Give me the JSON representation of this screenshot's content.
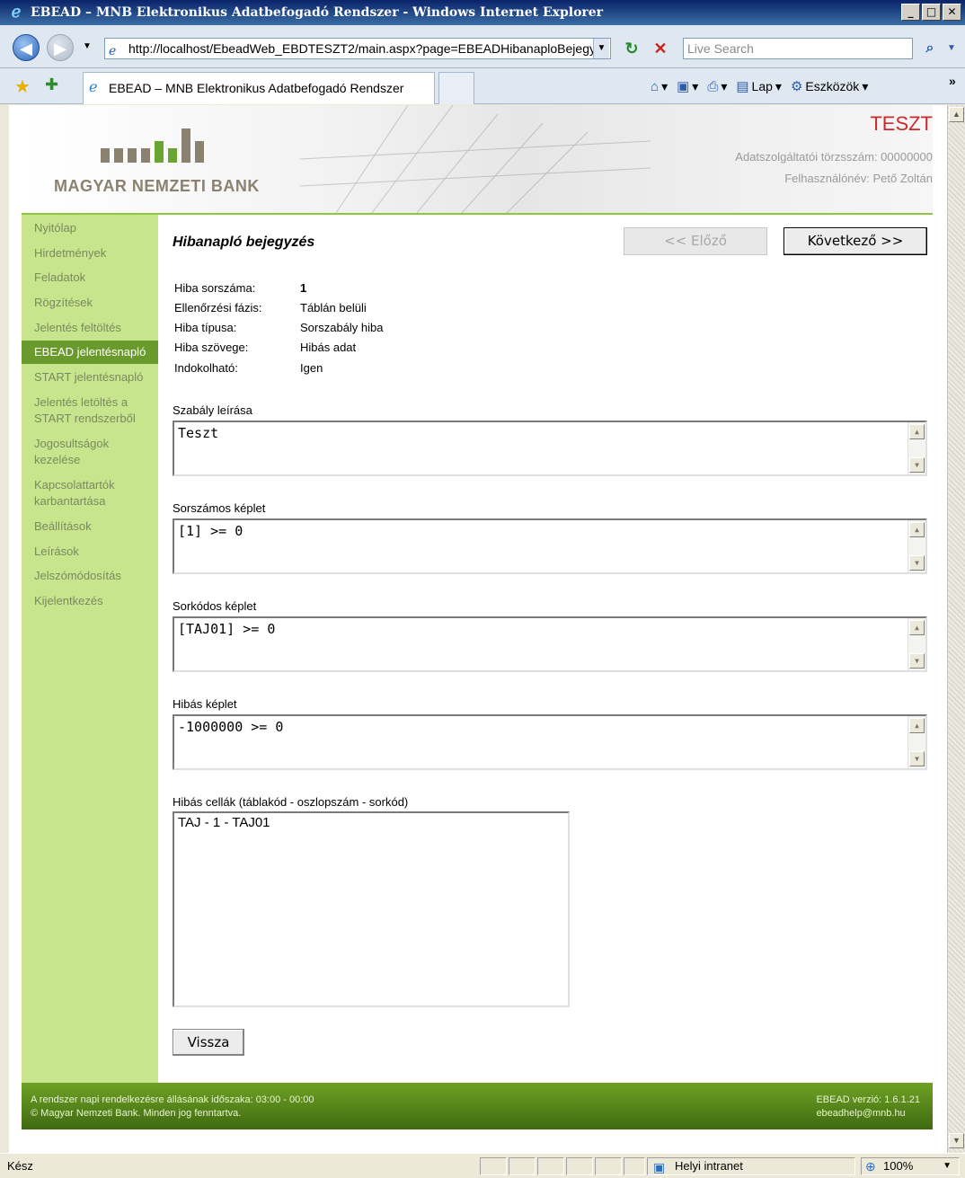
{
  "window": {
    "title": "EBEAD – MNB Elektronikus Adatbefogadó Rendszer - Windows Internet Explorer"
  },
  "browser": {
    "url": "http://localhost/EbeadWeb_EBDTESZT2/main.aspx?page=EBEADHibanaploBejegy",
    "search_placeholder": "Live Search",
    "tab_title": "EBEAD – MNB Elektronikus Adatbefogadó Rendszer",
    "commands": {
      "page": "Lap",
      "tools": "Eszközök"
    },
    "status": "Kész",
    "zone": "Helyi intranet",
    "zoom": "100%"
  },
  "header": {
    "bank_name": "MAGYAR NEMZETI BANK",
    "env_label": "TESZT",
    "provider_id_label": "Adatszolgáltatói törzsszám:",
    "provider_id_value": "00000000",
    "username_label": "Felhasználónév:",
    "username_value": "Pető Zoltán",
    "brand_colors": {
      "grey_bar": "#8b8170",
      "green_bar": "#6ba531",
      "sidebar": "#c6e58c",
      "active": "#6b9a2c",
      "env": "#cc2a2a"
    }
  },
  "sidebar": {
    "items": [
      {
        "label": "Nyitólap"
      },
      {
        "label": "Hirdetmények"
      },
      {
        "label": "Feladatok"
      },
      {
        "label": "Rögzítések"
      },
      {
        "label": "Jelentés feltöltés"
      },
      {
        "label": "EBEAD jelentésnapló",
        "active": true
      },
      {
        "label": "START jelentésnapló"
      },
      {
        "label": "Jelentés letöltés a",
        "label2": "START rendszerből"
      },
      {
        "label": "Jogosultságok",
        "label2": "kezelése"
      },
      {
        "label": "Kapcsolattartók",
        "label2": "karbantartása"
      },
      {
        "label": "Beállítások"
      },
      {
        "label": "Leírások"
      },
      {
        "label": "Jelszómódosítás"
      },
      {
        "label": "Kijelentkezés"
      }
    ]
  },
  "main": {
    "title": "Hibanapló bejegyzés",
    "prev_label": "<< Előző",
    "next_label": "Következő >>",
    "info": [
      {
        "label": "Hiba sorszáma:",
        "value": "1"
      },
      {
        "label": "Ellenőrzési fázis:",
        "value": "Táblán belüli"
      },
      {
        "label": "Hiba típusa:",
        "value": "Sorszabály hiba"
      },
      {
        "label": "Hiba szövege:",
        "value": "Hibás adat"
      },
      {
        "label": "Indokolható:",
        "value": "Igen"
      }
    ],
    "fields": [
      {
        "label": "Szabály leírása",
        "value": "Teszt"
      },
      {
        "label": "Sorszámos képlet",
        "value": "[1] >= 0"
      },
      {
        "label": "Sorkódos képlet",
        "value": "[TAJ01] >= 0"
      },
      {
        "label": "Hibás képlet",
        "value": "-1000000 >= 0"
      }
    ],
    "cells_label": "Hibás cellák (táblakód - oszlopszám - sorkód)",
    "cells": [
      "TAJ - 1 - TAJ01"
    ],
    "back_label": "Vissza"
  },
  "footer": {
    "line1": "A rendszer napi rendelkezésre állásának időszaka: 03:00 - 00:00",
    "line2": "© Magyar Nemzeti Bank. Minden jog fenntartva.",
    "version": "EBEAD verzió: 1.6.1.21",
    "email": "ebeadhelp@mnb.hu"
  }
}
